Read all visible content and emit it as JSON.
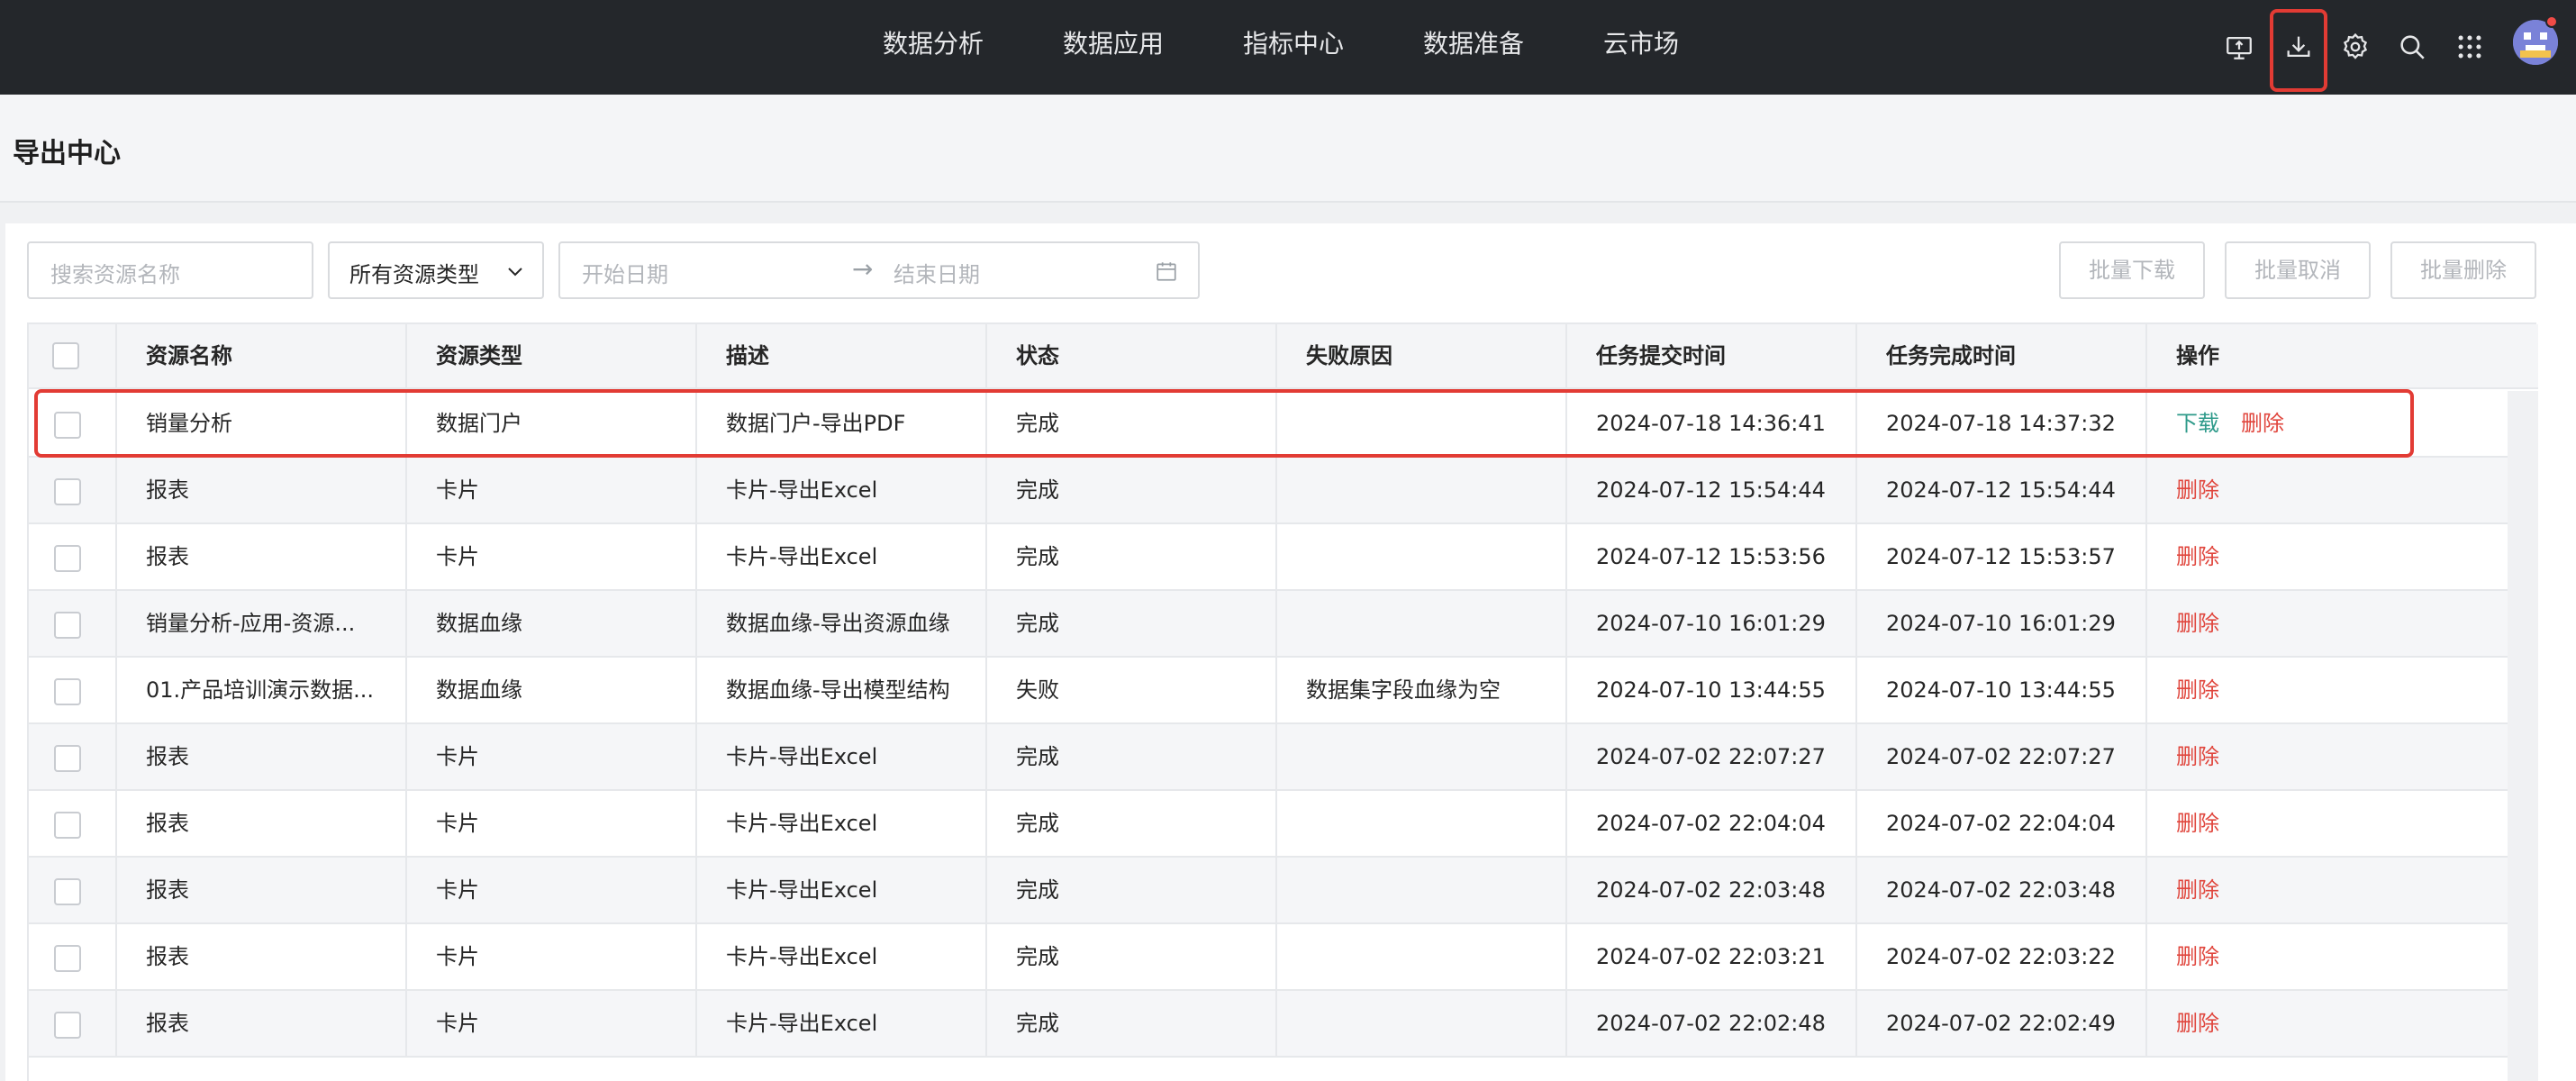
{
  "nav": {
    "items": [
      "数据分析",
      "数据应用",
      "指标中心",
      "数据准备",
      "云市场"
    ]
  },
  "toolbar_icons": [
    "monitor-upload-icon",
    "download-icon",
    "gear-icon",
    "search-icon",
    "apps-grid-icon"
  ],
  "page": {
    "title": "导出中心"
  },
  "filters": {
    "search_placeholder": "搜索资源名称",
    "type_select": "所有资源类型",
    "start_date_placeholder": "开始日期",
    "range_arrow": "→",
    "end_date_placeholder": "结束日期",
    "batch_download": "批量下载",
    "batch_cancel": "批量取消",
    "batch_delete": "批量删除"
  },
  "table": {
    "columns": [
      "资源名称",
      "资源类型",
      "描述",
      "状态",
      "失败原因",
      "任务提交时间",
      "任务完成时间",
      "操作"
    ],
    "rows": [
      {
        "name": "销量分析",
        "type": "数据门户",
        "desc": "数据门户-导出PDF",
        "status": "完成",
        "reason": "",
        "submit": "2024-07-18 14:36:41",
        "finish": "2024-07-18 14:37:32",
        "download": "下载",
        "delete": "删除"
      },
      {
        "name": "报表",
        "type": "卡片",
        "desc": "卡片-导出Excel",
        "status": "完成",
        "reason": "",
        "submit": "2024-07-12 15:54:44",
        "finish": "2024-07-12 15:54:44",
        "download": "",
        "delete": "删除"
      },
      {
        "name": "报表",
        "type": "卡片",
        "desc": "卡片-导出Excel",
        "status": "完成",
        "reason": "",
        "submit": "2024-07-12 15:53:56",
        "finish": "2024-07-12 15:53:57",
        "download": "",
        "delete": "删除"
      },
      {
        "name": "销量分析-应用-资源...",
        "type": "数据血缘",
        "desc": "数据血缘-导出资源血缘",
        "status": "完成",
        "reason": "",
        "submit": "2024-07-10 16:01:29",
        "finish": "2024-07-10 16:01:29",
        "download": "",
        "delete": "删除"
      },
      {
        "name": "01.产品培训演示数据...",
        "type": "数据血缘",
        "desc": "数据血缘-导出模型结构",
        "status": "失败",
        "reason": "数据集字段血缘为空",
        "submit": "2024-07-10 13:44:55",
        "finish": "2024-07-10 13:44:55",
        "download": "",
        "delete": "删除"
      },
      {
        "name": "报表",
        "type": "卡片",
        "desc": "卡片-导出Excel",
        "status": "完成",
        "reason": "",
        "submit": "2024-07-02 22:07:27",
        "finish": "2024-07-02 22:07:27",
        "download": "",
        "delete": "删除"
      },
      {
        "name": "报表",
        "type": "卡片",
        "desc": "卡片-导出Excel",
        "status": "完成",
        "reason": "",
        "submit": "2024-07-02 22:04:04",
        "finish": "2024-07-02 22:04:04",
        "download": "",
        "delete": "删除"
      },
      {
        "name": "报表",
        "type": "卡片",
        "desc": "卡片-导出Excel",
        "status": "完成",
        "reason": "",
        "submit": "2024-07-02 22:03:48",
        "finish": "2024-07-02 22:03:48",
        "download": "",
        "delete": "删除"
      },
      {
        "name": "报表",
        "type": "卡片",
        "desc": "卡片-导出Excel",
        "status": "完成",
        "reason": "",
        "submit": "2024-07-02 22:03:21",
        "finish": "2024-07-02 22:03:22",
        "download": "",
        "delete": "删除"
      },
      {
        "name": "报表",
        "type": "卡片",
        "desc": "卡片-导出Excel",
        "status": "完成",
        "reason": "",
        "submit": "2024-07-02 22:02:48",
        "finish": "2024-07-02 22:02:49",
        "download": "",
        "delete": "删除"
      }
    ]
  },
  "colors": {
    "topbar": "#24272b",
    "highlight": "#e23b34",
    "download_link": "#2e9a8a",
    "delete_link": "#e0463d"
  }
}
